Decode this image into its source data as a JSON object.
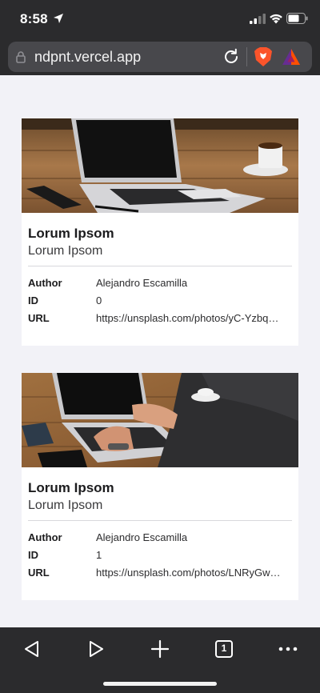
{
  "status_bar": {
    "time": "8:58"
  },
  "browser": {
    "url": "ndpnt.vercel.app",
    "tab_count": "1"
  },
  "cards": [
    {
      "title": "Lorum Ipsom",
      "subtitle": "Lorum Ipsom",
      "author_label": "Author",
      "author": "Alejandro Escamilla",
      "id_label": "ID",
      "id": "0",
      "url_label": "URL",
      "url": "https://unsplash.com/photos/yC-Yzbq…",
      "image_icon": "laptop-on-desk-photo"
    },
    {
      "title": "Lorum Ipsom",
      "subtitle": "Lorum Ipsom",
      "author_label": "Author",
      "author": "Alejandro Escamilla",
      "id_label": "ID",
      "id": "1",
      "url_label": "URL",
      "url": "https://unsplash.com/photos/LNRyGw…",
      "image_icon": "person-typing-laptop-photo"
    }
  ],
  "colors": {
    "chrome": "#2b2b2d",
    "urlbar": "#48484c",
    "page_bg": "#f2f2f7",
    "card_bg": "#ffffff"
  }
}
